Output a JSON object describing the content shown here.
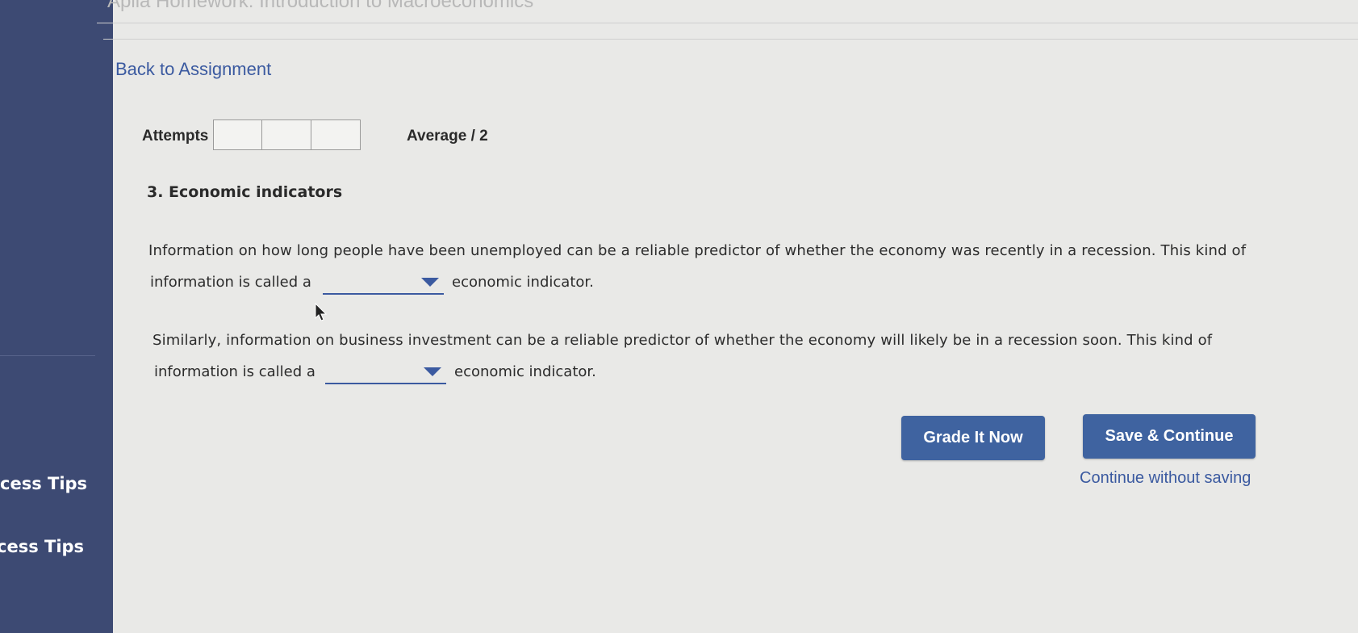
{
  "header": {
    "title": "Aplia Homework: Introduction to Macroeconomics",
    "back_link": "Back to Assignment"
  },
  "attempts": {
    "label": "Attempts",
    "boxes": 3,
    "average_label": "Average / 2"
  },
  "question": {
    "title": "3. Economic indicators",
    "paragraph1": {
      "line1": "Information on how long people have been unemployed can be a reliable predictor of whether the economy was recently in a recession. This kind of",
      "before": "information is called a",
      "after": "economic indicator.",
      "dropdown_value": ""
    },
    "paragraph2": {
      "line1": "Similarly, information on business investment can be a reliable predictor of whether the economy will likely be in a recession soon. This kind of",
      "before": "information is called a",
      "after": "economic indicator.",
      "dropdown_value": ""
    }
  },
  "buttons": {
    "grade": "Grade It Now",
    "save": "Save & Continue",
    "continue_without_saving": "Continue without saving"
  },
  "sidebar": {
    "items": [
      {
        "label": "cess Tips"
      },
      {
        "label": "cess Tips"
      }
    ]
  },
  "colors": {
    "sidebar": "#3d4a73",
    "accent": "#3f63a0",
    "link": "#3b5aa0",
    "background": "#e9e9e7"
  },
  "icons": {
    "dropdown": "caret-down-icon",
    "pointer": "mouse-cursor-icon"
  }
}
